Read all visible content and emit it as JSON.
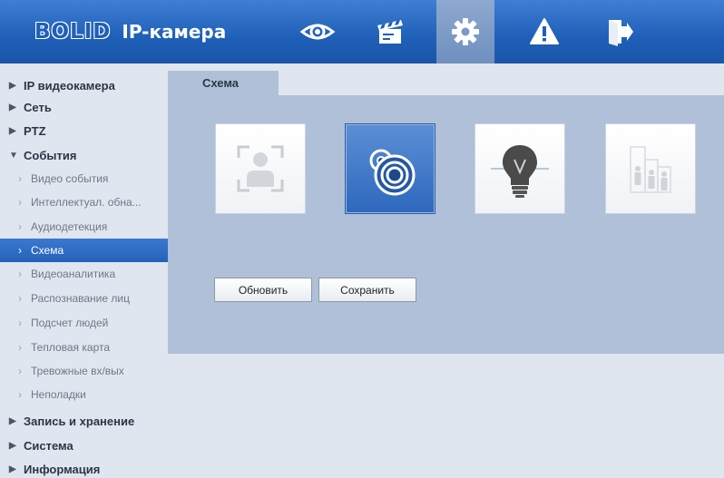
{
  "header": {
    "brand": "BOLID",
    "product": "IP-камера",
    "nav": [
      {
        "name": "live-view",
        "icon": "eye-icon"
      },
      {
        "name": "playback",
        "icon": "clapperboard-icon"
      },
      {
        "name": "settings",
        "icon": "gear-icon",
        "active": true
      },
      {
        "name": "alarm",
        "icon": "warning-icon"
      },
      {
        "name": "logout",
        "icon": "logout-icon"
      }
    ]
  },
  "sidebar": {
    "groups": {
      "ip_camera": "IP видеокамера",
      "network": "Сеть",
      "ptz": "PTZ",
      "events": "События",
      "storage": "Запись и хранение",
      "system": "Система",
      "info": "Информация"
    },
    "events_items": [
      "Видео события",
      "Интеллектуал. обна...",
      "Аудиодетекция",
      "Схема",
      "Видеоаналитика",
      "Распознавание лиц",
      "Подсчет людей",
      "Тепловая карта",
      "Тревожные вх/вых",
      "Неполадки"
    ],
    "active_item": "Схема"
  },
  "main": {
    "tab_label": "Схема",
    "schemes": [
      {
        "icon": "face-detection-icon",
        "selected": false
      },
      {
        "icon": "fisheye-camera-icon",
        "selected": true
      },
      {
        "icon": "heat-map-icon",
        "selected": false
      },
      {
        "icon": "people-counting-icon",
        "selected": false
      }
    ],
    "refresh_label": "Обновить",
    "save_label": "Сохранить"
  },
  "colors": {
    "header": "#1f5fb8",
    "active_item": "#2a67bf",
    "content": "#b0c0d9",
    "page": "#dfe6ef"
  }
}
